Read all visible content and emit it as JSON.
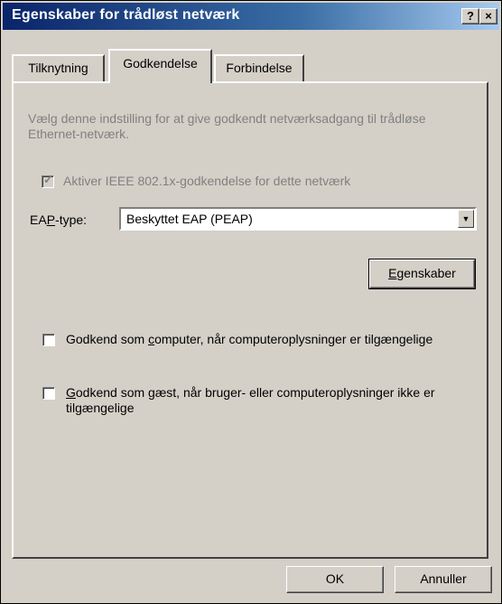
{
  "window": {
    "title": "Egenskaber for trådløst netværk",
    "help_label": "?",
    "close_label": "×"
  },
  "tabs": [
    {
      "label": "Tilknytning",
      "active": false
    },
    {
      "label": "Godkendelse",
      "active": true
    },
    {
      "label": "Forbindelse",
      "active": false
    }
  ],
  "description": "Vælg denne indstilling for at give godkendt netværksadgang til trådløse Ethernet-netværk.",
  "enable_8021x": {
    "label": "Aktiver IEEE 802.1x-godkendelse for dette netværk",
    "checked": true,
    "disabled": true
  },
  "eap": {
    "label_pre": "EA",
    "label_accel": "P",
    "label_post": "-type:",
    "value": "Beskyttet EAP (PEAP)"
  },
  "properties_button": {
    "accel": "E",
    "rest": "genskaber"
  },
  "auth_computer": {
    "pre": "Godkend som ",
    "accel": "c",
    "post": "omputer, når computeroplysninger er tilgængelige",
    "checked": false
  },
  "auth_guest": {
    "accel": "G",
    "post": "odkend som gæst, når bruger- eller computeroplysninger ikke er tilgængelige",
    "checked": false
  },
  "buttons": {
    "ok": "OK",
    "cancel": "Annuller"
  }
}
